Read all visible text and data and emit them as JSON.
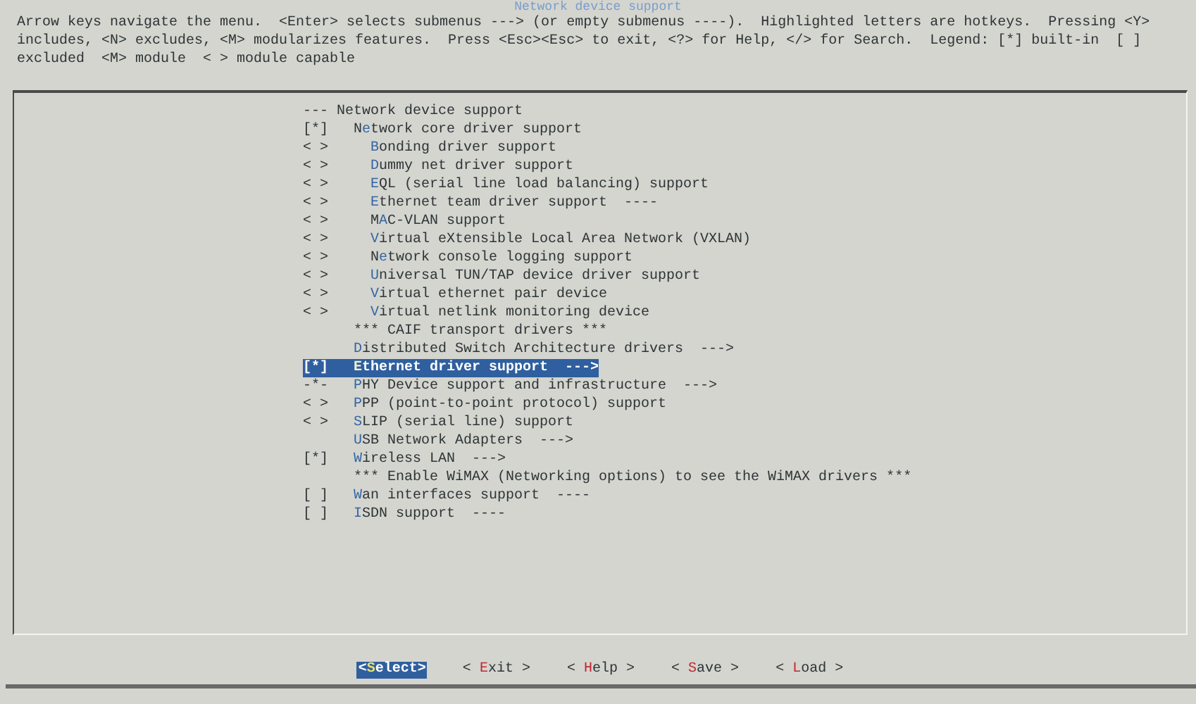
{
  "window": {
    "title": "Network device support"
  },
  "help_text": "Arrow keys navigate the menu.  <Enter> selects submenus ---> (or empty submenus ----).  Highlighted letters are hotkeys.  Pressing <Y> includes, <N> excludes, <M> modularizes features.  Press <Esc><Esc> to exit, <?> for Help, </> for Search.  Legend: [*] built-in  [ ] excluded  <M> module  < > module capable",
  "menu": [
    {
      "kind": "heading",
      "marker": "---",
      "text": "Network device support",
      "selected": false
    },
    {
      "kind": "option",
      "marker": "[*]",
      "text": "N**e**twork core driver support",
      "selected": false,
      "children": [
        {
          "kind": "option",
          "marker": "< >",
          "text": "**B**onding driver support",
          "selected": false
        },
        {
          "kind": "option",
          "marker": "< >",
          "text": "**D**ummy net driver support",
          "selected": false
        },
        {
          "kind": "option",
          "marker": "< >",
          "text": "**E**QL (serial line load balancing) support",
          "selected": false
        },
        {
          "kind": "option",
          "marker": "< >",
          "text": "**E**thernet team driver support  ----",
          "selected": false
        },
        {
          "kind": "option",
          "marker": "< >",
          "text": "M**A**C-VLAN support",
          "selected": false
        },
        {
          "kind": "option",
          "marker": "< >",
          "text": "**V**irtual eXtensible Local Area Network (VXLAN)",
          "selected": false
        },
        {
          "kind": "option",
          "marker": "< >",
          "text": "N**e**twork console logging support",
          "selected": false
        },
        {
          "kind": "option",
          "marker": "< >",
          "text": "**U**niversal TUN/TAP device driver support",
          "selected": false
        },
        {
          "kind": "option",
          "marker": "< >",
          "text": "**V**irtual ethernet pair device",
          "selected": false
        },
        {
          "kind": "option",
          "marker": "< >",
          "text": "**V**irtual netlink monitoring device",
          "selected": false
        }
      ]
    },
    {
      "kind": "comment",
      "text": "*** CAIF transport drivers ***",
      "selected": false
    },
    {
      "kind": "option",
      "text": "**D**istributed Switch Architecture drivers  --->",
      "selected": false
    },
    {
      "kind": "option",
      "marker": "[*]",
      "text": "**E**thernet driver support  --->",
      "selected": true
    },
    {
      "kind": "option",
      "marker": "-*-",
      "text": "**P**HY Device support and infrastructure  --->",
      "selected": false
    },
    {
      "kind": "option",
      "marker": "< >",
      "text": "**P**PP (point-to-point protocol) support",
      "selected": false
    },
    {
      "kind": "option",
      "marker": "< >",
      "text": "**S**LIP (serial line) support",
      "selected": false
    },
    {
      "kind": "option",
      "text": "**U**SB Network Adapters  --->",
      "selected": false
    },
    {
      "kind": "option",
      "marker": "[*]",
      "text": "**W**ireless LAN  --->",
      "selected": false
    },
    {
      "kind": "comment",
      "text": "*** Enable WiMAX (Networking options) to see the WiMAX drivers ***",
      "selected": false
    },
    {
      "kind": "option",
      "marker": "[ ]",
      "text": "**W**an interfaces support  ----",
      "selected": false
    },
    {
      "kind": "option",
      "marker": "[ ]",
      "text": "**I**SDN support  ----",
      "selected": false
    }
  ],
  "buttons": [
    {
      "label": "<**S**elect>",
      "selected": true
    },
    {
      "label": "< **E**xit >",
      "selected": false
    },
    {
      "label": "< **H**elp >",
      "selected": false
    },
    {
      "label": "< **S**ave >",
      "selected": false
    },
    {
      "label": "< **L**oad >",
      "selected": false
    }
  ]
}
